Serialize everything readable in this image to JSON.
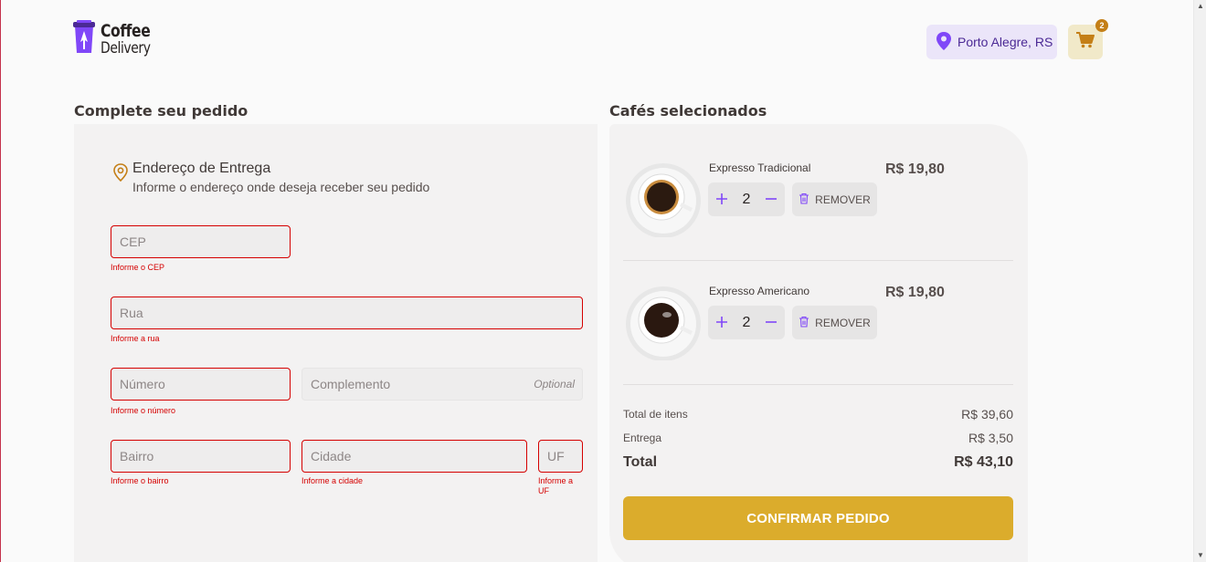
{
  "header": {
    "logo_line1": "Coffee",
    "logo_line2": "Delivery",
    "location": "Porto Alegre, RS",
    "cart_count": "2"
  },
  "form": {
    "section_title": "Complete seu pedido",
    "address_title": "Endereço de Entrega",
    "address_subtitle": "Informe o endereço onde deseja receber seu pedido",
    "fields": {
      "cep": {
        "placeholder": "CEP",
        "error": "Informe o CEP"
      },
      "rua": {
        "placeholder": "Rua",
        "error": "Informe a rua"
      },
      "numero": {
        "placeholder": "Número",
        "error": "Informe o número"
      },
      "complemento": {
        "placeholder": "Complemento",
        "optional": "Optional"
      },
      "bairro": {
        "placeholder": "Bairro",
        "error": "Informe o bairro"
      },
      "cidade": {
        "placeholder": "Cidade",
        "error": "Informe a cidade"
      },
      "uf": {
        "placeholder": "UF",
        "error": "Informe a UF"
      }
    }
  },
  "cart": {
    "section_title": "Cafés selecionados",
    "items": [
      {
        "name": "Expresso Tradicional",
        "quantity": "2",
        "price": "R$ 19,80",
        "remove_label": "REMOVER"
      },
      {
        "name": "Expresso Americano",
        "quantity": "2",
        "price": "R$ 19,80",
        "remove_label": "REMOVER"
      }
    ],
    "summary": {
      "items_label": "Total de itens",
      "items_value": "R$ 39,60",
      "delivery_label": "Entrega",
      "delivery_value": "R$ 3,50",
      "total_label": "Total",
      "total_value": "R$ 43,10"
    },
    "confirm_label": "CONFIRMAR PEDIDO"
  },
  "colors": {
    "purple": "#8047f8",
    "purple_dark": "#4b2995",
    "yellow": "#dbac2c",
    "yellow_dark": "#c47f17",
    "error": "#d50000"
  },
  "icons": [
    "coffee-cup-logo-icon",
    "map-pin-icon",
    "shopping-cart-icon",
    "map-pin-outline-icon",
    "plus-icon",
    "minus-icon",
    "trash-icon"
  ]
}
